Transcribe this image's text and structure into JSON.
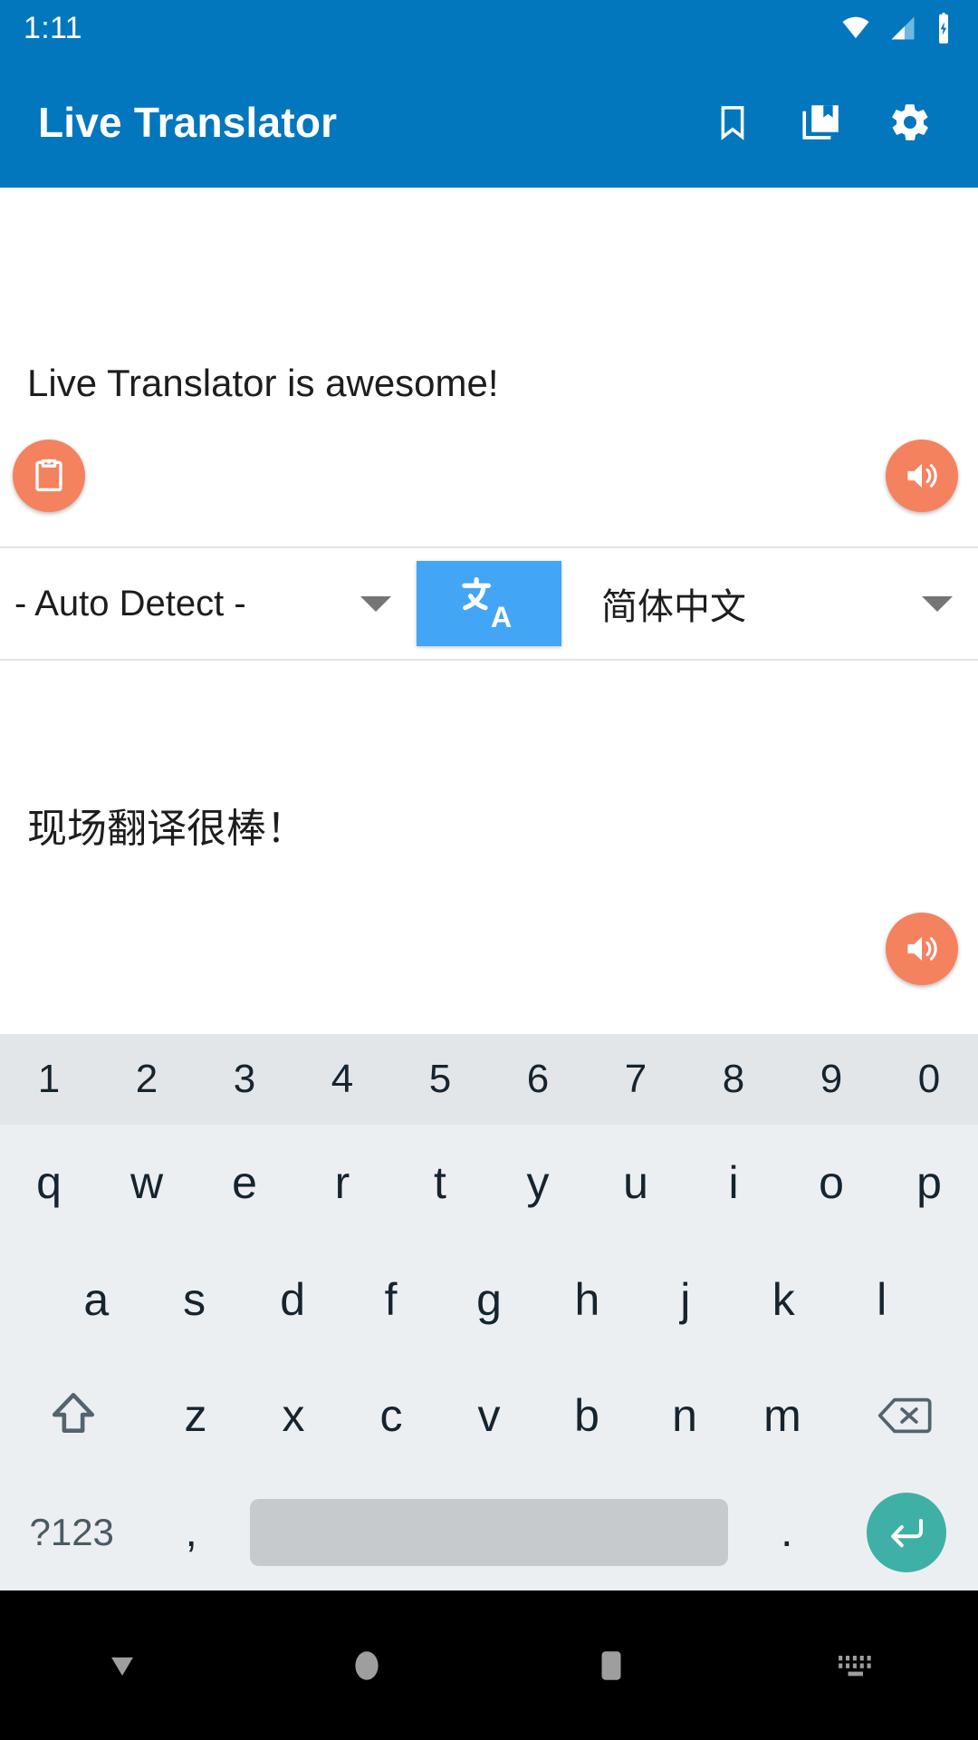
{
  "status_bar": {
    "time": "1:11",
    "icons": [
      "wifi-icon",
      "cellular-signal-icon",
      "battery-charging-icon"
    ]
  },
  "app_bar": {
    "title": "Live Translator",
    "actions": [
      {
        "name": "bookmark-icon",
        "label": "Bookmark"
      },
      {
        "name": "collections-bookmark-icon",
        "label": "Saved translations"
      },
      {
        "name": "gear-icon",
        "label": "Settings"
      }
    ]
  },
  "source": {
    "text": "Live Translator is awesome!",
    "paste_button": "paste-icon",
    "speak_button": "speaker-icon"
  },
  "language_bar": {
    "source_language": "- Auto Detect -",
    "target_language": "简体中文",
    "translate_button_glyph": "文A",
    "translate_button_name": "translate-icon"
  },
  "target": {
    "text": "现场翻译很棒！",
    "speak_button": "speaker-icon"
  },
  "keyboard": {
    "numbers": [
      "1",
      "2",
      "3",
      "4",
      "5",
      "6",
      "7",
      "8",
      "9",
      "0"
    ],
    "row1": [
      "q",
      "w",
      "e",
      "r",
      "t",
      "y",
      "u",
      "i",
      "o",
      "p"
    ],
    "row2": [
      "a",
      "s",
      "d",
      "f",
      "g",
      "h",
      "j",
      "k",
      "l"
    ],
    "row3": [
      "z",
      "x",
      "c",
      "v",
      "b",
      "n",
      "m"
    ],
    "shift_key": "shift-icon",
    "backspace_key": "backspace-icon",
    "symbols_key": "?123",
    "comma_key": ",",
    "space_key": "",
    "period_key": ".",
    "enter_key": "enter-icon"
  },
  "nav_bar": {
    "buttons": [
      {
        "name": "back-dismiss-keyboard-icon"
      },
      {
        "name": "home-icon"
      },
      {
        "name": "recents-icon"
      },
      {
        "name": "keyboard-switcher-icon"
      }
    ]
  },
  "colors": {
    "app_bar": "#0277bd",
    "accent_fab": "#f4825f",
    "translate_button": "#42a5f5",
    "enter_key": "#3fb0a5",
    "keyboard_bg": "#eceff1",
    "number_row_bg": "#e3e6e8",
    "spacebar": "#c6cacc",
    "nav_bar": "#000000"
  }
}
